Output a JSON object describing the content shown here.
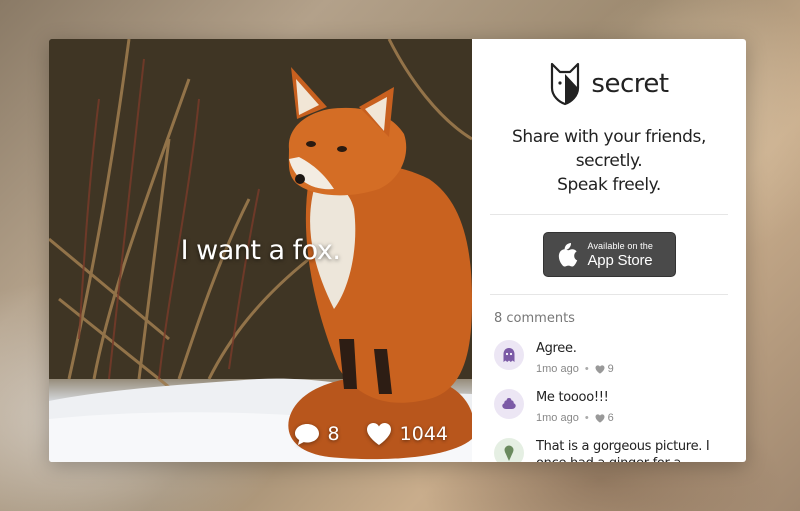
{
  "post": {
    "text": "I want a fox.",
    "comment_count": "8",
    "like_count": "1044"
  },
  "brand": {
    "name": "secret",
    "tagline_line1": "Share with your friends, secretly.",
    "tagline_line2": "Speak freely."
  },
  "app_store": {
    "small_label": "Available on the",
    "big_label": "App Store"
  },
  "comments": {
    "count_label": "8 comments",
    "items": [
      {
        "text": "Agree.",
        "time": "1mo ago",
        "likes": "9",
        "avatar_color": "#ece6f4",
        "avatar_fg": "#7b5aa6",
        "avatar_icon": "ghost-icon"
      },
      {
        "text": "Me toooo!!!",
        "time": "1mo ago",
        "likes": "6",
        "avatar_color": "#ece6f4",
        "avatar_fg": "#7b5aa6",
        "avatar_icon": "swirl-icon"
      },
      {
        "text": "That is a gorgeous picture. I once had a ginger for a girlfriend once... Quite foxy.",
        "time": "1mo ago",
        "likes": "",
        "avatar_color": "#e5efe3",
        "avatar_fg": "#6a8a5e",
        "avatar_icon": "ice-cream-icon"
      }
    ]
  }
}
